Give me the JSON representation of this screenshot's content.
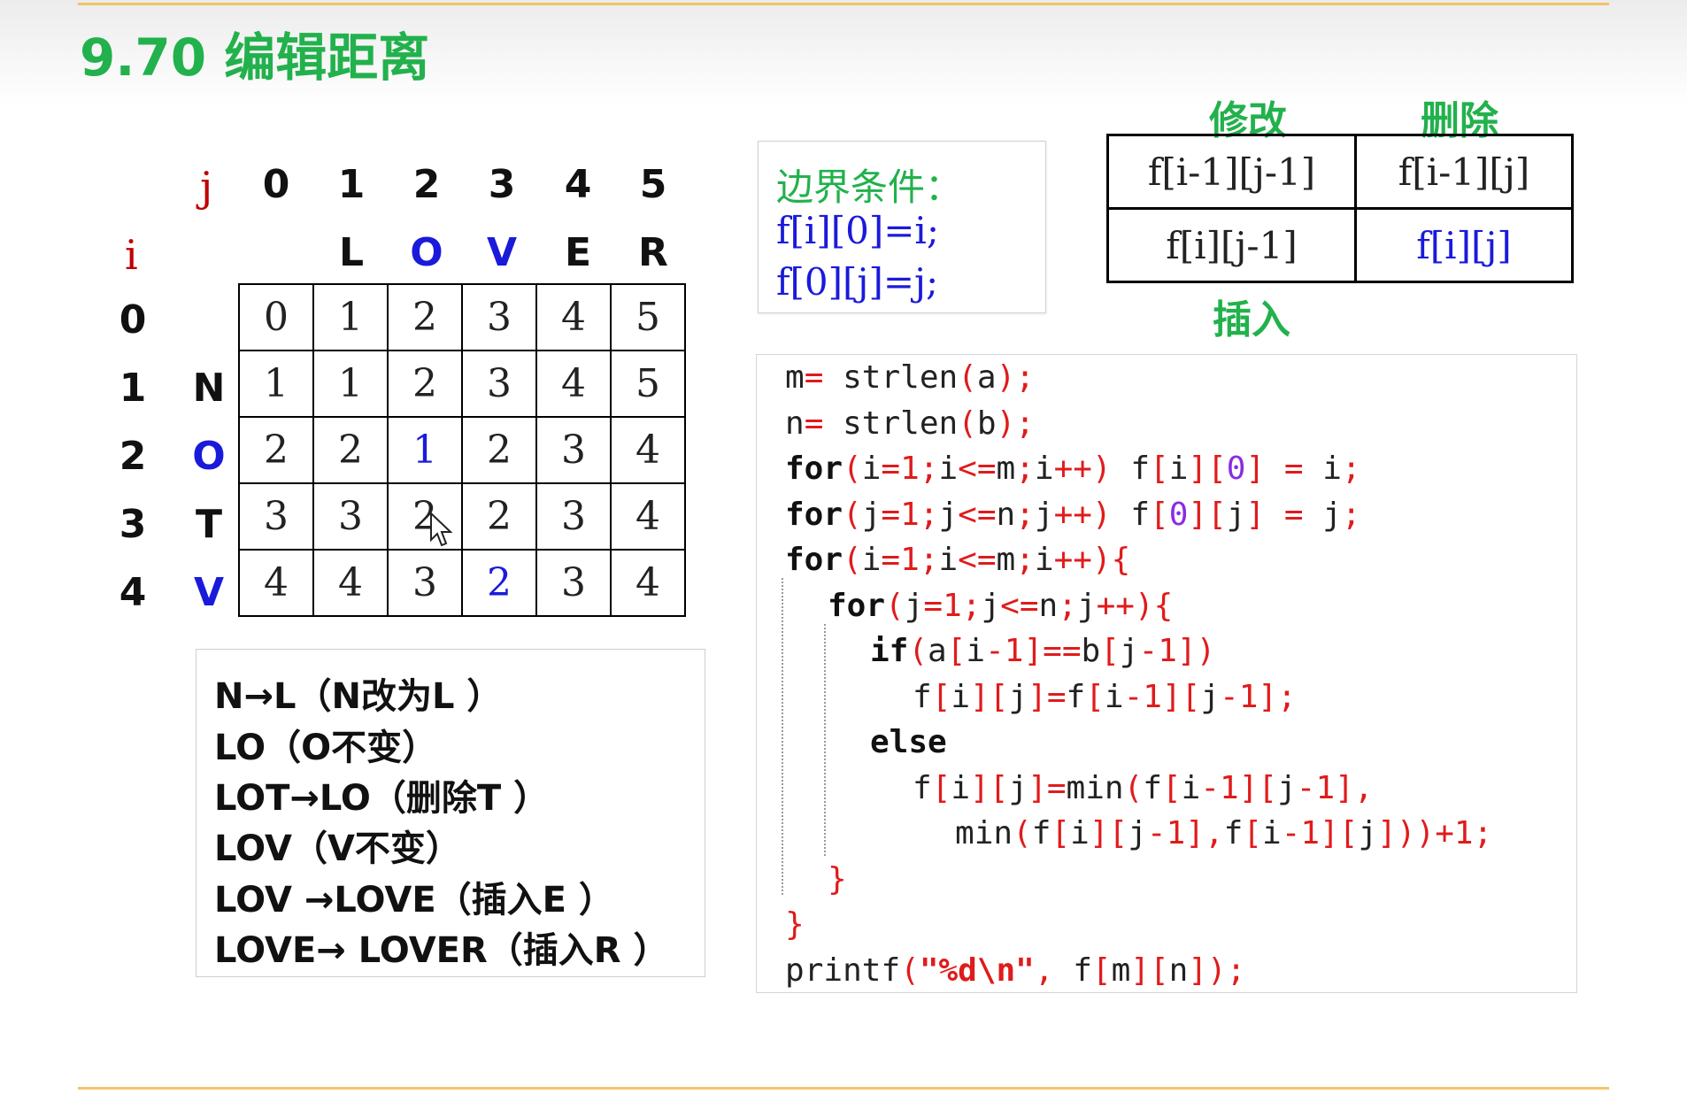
{
  "slide": {
    "title": "9.70 编辑距离"
  },
  "dp_grid": {
    "j_label": "j",
    "i_label": "i",
    "col_indices": [
      "0",
      "1",
      "2",
      "3",
      "4",
      "5"
    ],
    "col_letters": [
      "",
      "L",
      "O",
      "V",
      "E",
      "R"
    ],
    "row_indices": [
      "0",
      "1",
      "2",
      "3",
      "4"
    ],
    "row_letters": [
      "",
      "N",
      "O",
      "T",
      "V"
    ],
    "cells": [
      [
        "0",
        "1",
        "2",
        "3",
        "4",
        "5"
      ],
      [
        "1",
        "1",
        "2",
        "3",
        "4",
        "5"
      ],
      [
        "2",
        "2",
        "1",
        "2",
        "3",
        "4"
      ],
      [
        "3",
        "3",
        "2",
        "2",
        "3",
        "4"
      ],
      [
        "4",
        "4",
        "3",
        "2",
        "3",
        "4"
      ]
    ],
    "highlight_color": "#1a1adb"
  },
  "boundary": {
    "heading": "边界条件：",
    "line1": "f[i][0]=i;",
    "line2": "f[0][j]=j;"
  },
  "relation": {
    "label_modify": "修改",
    "label_delete": "删除",
    "label_insert": "插入",
    "cell_tl": "f[i-1][j-1]",
    "cell_tr": "f[i-1][j]",
    "cell_bl": "f[i][j-1]",
    "cell_br": "f[i][j]"
  },
  "steps": [
    "N→L（N改为L ）",
    "LO（O不变）",
    "LOT→LO（删除T ）",
    "LOV（V不变）",
    "LOV →LOVE（插入E ）",
    "LOVE→ LOVER（插入R ）"
  ],
  "code": {
    "lines": [
      "m= strlen(a);",
      "n= strlen(b);",
      "for(i=1;i<=m;i++) f[i][0] = i;",
      "for(j=1;j<=n;j++) f[0][j] = j;",
      "for(i=1;i<=m;i++){",
      "for(j=1;j<=n;j++){",
      "if(a[i-1]==b[j-1])",
      "f[i][j]=f[i-1][j-1];",
      "else",
      "f[i][j]=min(f[i-1][j-1],",
      "min(f[i][j-1],f[i-1][j]))+1;",
      "}",
      "}",
      "printf(\"%d\\n\", f[m][n]);"
    ]
  },
  "colors": {
    "accent_green": "#22b14c",
    "code_red": "#e01b1b",
    "code_purple": "#8a2be2",
    "blue": "#1a1adb",
    "dark_red": "#c00000",
    "rule_orange": "#f2c46a"
  }
}
